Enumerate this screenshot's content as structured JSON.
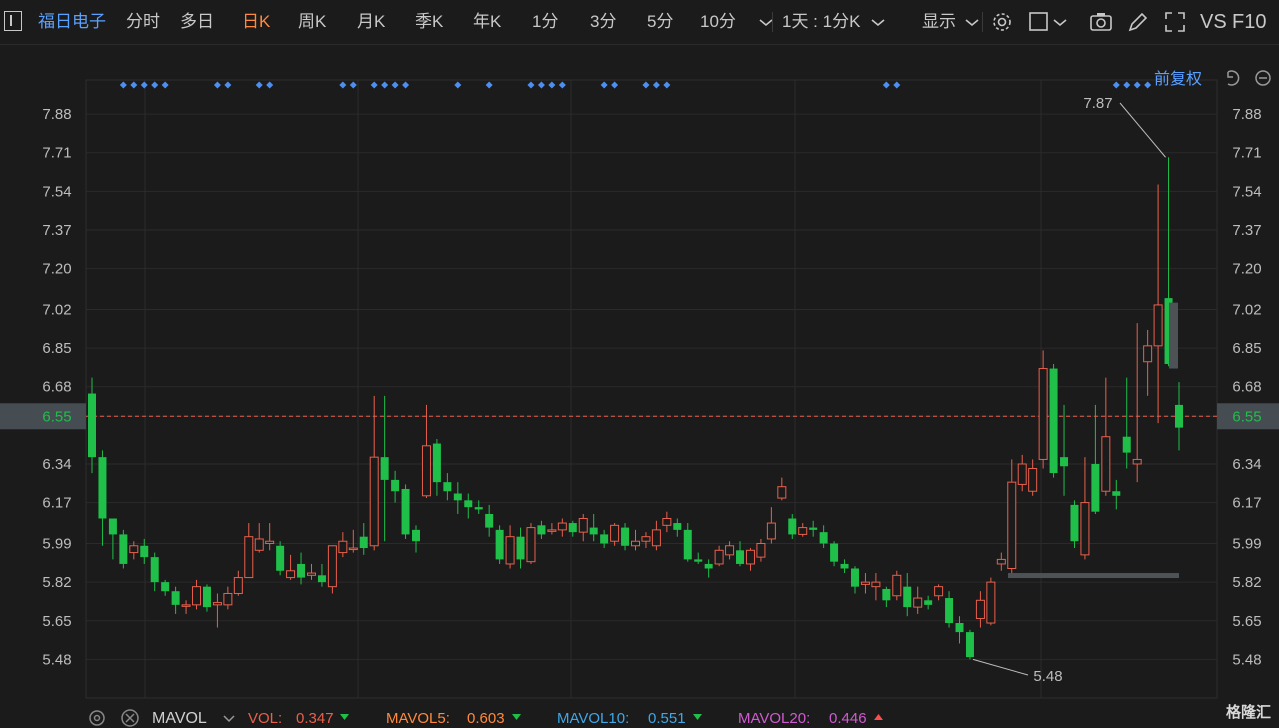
{
  "toolbar": {
    "stock_name": "福日电子",
    "tabs": [
      "分时",
      "多日",
      "日K",
      "周K",
      "月K",
      "季K",
      "年K",
      "1分",
      "3分",
      "5分",
      "10分"
    ],
    "active_tab": "日K",
    "period_select": "1天 : 1分K",
    "display_label": "显示",
    "right_labels": [
      "VS",
      "F10"
    ]
  },
  "adjust_label": "前复权",
  "price_marker": {
    "current": "6.55",
    "high_label": "7.87",
    "low_label": "5.48"
  },
  "footer": {
    "indicator": "MAVOL",
    "items": [
      {
        "name": "VOL:",
        "value": "0.347",
        "name_color": "#e8604c",
        "value_color": "#e8604c",
        "arrow": "down",
        "arrow_color": "#1fbf4a"
      },
      {
        "name": "MAVOL5:",
        "value": "0.603",
        "name_color": "#ff8a3d",
        "value_color": "#ff8a3d",
        "arrow": "down",
        "arrow_color": "#1fbf4a"
      },
      {
        "name": "MAVOL10:",
        "value": "0.551",
        "name_color": "#3fa7e8",
        "value_color": "#3fa7e8",
        "arrow": "down",
        "arrow_color": "#1fbf4a"
      },
      {
        "name": "MAVOL20:",
        "value": "0.446",
        "name_color": "#d05ad0",
        "value_color": "#d05ad0",
        "arrow": "up",
        "arrow_color": "#ff4c4c"
      }
    ]
  },
  "watermark": "格隆汇",
  "chart_data": {
    "type": "candlestick",
    "y_ticks": [
      "7.88",
      "7.71",
      "7.54",
      "7.37",
      "7.20",
      "7.02",
      "6.85",
      "6.68",
      "6.55",
      "6.34",
      "6.17",
      "5.99",
      "5.82",
      "5.65",
      "5.48"
    ],
    "y_range": [
      5.31,
      8.03
    ],
    "current_price": 6.55,
    "up_color": "#e8604c",
    "down_color": "#1fbf4a",
    "marker_color": "#4c8ff0",
    "markers": [
      3,
      4,
      5,
      6,
      7,
      12,
      13,
      16,
      17,
      24,
      25,
      27,
      28,
      29,
      30,
      35,
      38,
      42,
      43,
      44,
      45,
      49,
      50,
      53,
      54,
      55,
      76,
      77,
      98,
      99,
      100,
      101
    ],
    "candles": [
      [
        6.65,
        6.37,
        6.72,
        6.3
      ],
      [
        6.37,
        6.1,
        6.4,
        5.98
      ],
      [
        6.1,
        6.03,
        6.1,
        5.92
      ],
      [
        6.03,
        5.9,
        6.05,
        5.88
      ],
      [
        5.95,
        5.98,
        6.0,
        5.92
      ],
      [
        5.98,
        5.93,
        6.01,
        5.9
      ],
      [
        5.93,
        5.82,
        5.95,
        5.78
      ],
      [
        5.82,
        5.78,
        5.83,
        5.76
      ],
      [
        5.78,
        5.72,
        5.8,
        5.68
      ],
      [
        5.72,
        5.72,
        5.74,
        5.68
      ],
      [
        5.72,
        5.8,
        5.83,
        5.7
      ],
      [
        5.8,
        5.71,
        5.81,
        5.69
      ],
      [
        5.72,
        5.73,
        5.77,
        5.62
      ],
      [
        5.72,
        5.77,
        5.8,
        5.7
      ],
      [
        5.77,
        5.84,
        5.87,
        5.76
      ],
      [
        5.84,
        6.02,
        6.08,
        5.84
      ],
      [
        5.96,
        6.01,
        6.08,
        5.95
      ],
      [
        5.99,
        6.0,
        6.08,
        5.96
      ],
      [
        5.98,
        5.87,
        6.0,
        5.85
      ],
      [
        5.84,
        5.87,
        5.94,
        5.83
      ],
      [
        5.9,
        5.84,
        5.95,
        5.81
      ],
      [
        5.85,
        5.86,
        5.9,
        5.83
      ],
      [
        5.85,
        5.82,
        5.9,
        5.8
      ],
      [
        5.8,
        5.98,
        5.98,
        5.77
      ],
      [
        5.95,
        6.0,
        6.04,
        5.93
      ],
      [
        5.97,
        5.97,
        6.05,
        5.95
      ],
      [
        6.02,
        5.97,
        6.08,
        5.94
      ],
      [
        5.98,
        6.37,
        6.64,
        5.96
      ],
      [
        6.37,
        6.27,
        6.64,
        6.0
      ],
      [
        6.27,
        6.22,
        6.31,
        6.17
      ],
      [
        6.23,
        6.03,
        6.25,
        6.01
      ],
      [
        6.05,
        6.0,
        6.07,
        5.95
      ],
      [
        6.2,
        6.42,
        6.6,
        6.19
      ],
      [
        6.43,
        6.26,
        6.45,
        6.2
      ],
      [
        6.26,
        6.22,
        6.3,
        6.18
      ],
      [
        6.21,
        6.18,
        6.26,
        6.12
      ],
      [
        6.18,
        6.15,
        6.21,
        6.1
      ],
      [
        6.15,
        6.14,
        6.18,
        6.12
      ],
      [
        6.12,
        6.06,
        6.16,
        6.02
      ],
      [
        6.05,
        5.92,
        6.07,
        5.9
      ],
      [
        5.9,
        6.02,
        6.07,
        5.88
      ],
      [
        6.02,
        5.92,
        6.06,
        5.88
      ],
      [
        5.91,
        6.06,
        6.08,
        5.9
      ],
      [
        6.07,
        6.03,
        6.09,
        6.01
      ],
      [
        6.05,
        6.05,
        6.08,
        6.03
      ],
      [
        6.05,
        6.08,
        6.1,
        6.02
      ],
      [
        6.08,
        6.04,
        6.09,
        6.02
      ],
      [
        6.04,
        6.1,
        6.12,
        6.0
      ],
      [
        6.06,
        6.03,
        6.12,
        6.0
      ],
      [
        6.03,
        5.99,
        6.05,
        5.97
      ],
      [
        6.0,
        6.07,
        6.08,
        5.98
      ],
      [
        6.06,
        5.98,
        6.08,
        5.96
      ],
      [
        5.98,
        6.0,
        6.05,
        5.96
      ],
      [
        6.0,
        6.02,
        6.04,
        5.97
      ],
      [
        5.98,
        6.05,
        6.09,
        5.96
      ],
      [
        6.07,
        6.1,
        6.13,
        6.04
      ],
      [
        6.08,
        6.05,
        6.1,
        6.02
      ],
      [
        6.05,
        5.92,
        6.08,
        5.91
      ],
      [
        5.92,
        5.91,
        5.95,
        5.9
      ],
      [
        5.9,
        5.88,
        5.92,
        5.84
      ],
      [
        5.9,
        5.96,
        5.98,
        5.89
      ],
      [
        5.94,
        5.98,
        6.0,
        5.92
      ],
      [
        5.96,
        5.9,
        6.0,
        5.89
      ],
      [
        5.9,
        5.96,
        5.97,
        5.87
      ],
      [
        5.93,
        5.99,
        6.01,
        5.91
      ],
      [
        6.01,
        6.08,
        6.15,
        5.99
      ],
      [
        6.19,
        6.24,
        6.28,
        6.18
      ],
      [
        6.1,
        6.03,
        6.12,
        6.01
      ],
      [
        6.03,
        6.06,
        6.08,
        6.02
      ],
      [
        6.06,
        6.05,
        6.09,
        6.02
      ],
      [
        6.04,
        5.99,
        6.07,
        5.97
      ],
      [
        5.99,
        5.91,
        6.0,
        5.89
      ],
      [
        5.9,
        5.88,
        5.92,
        5.86
      ],
      [
        5.88,
        5.8,
        5.89,
        5.77
      ],
      [
        5.81,
        5.82,
        5.86,
        5.77
      ],
      [
        5.8,
        5.82,
        5.86,
        5.74
      ],
      [
        5.79,
        5.74,
        5.8,
        5.71
      ],
      [
        5.76,
        5.85,
        5.87,
        5.74
      ],
      [
        5.8,
        5.71,
        5.86,
        5.67
      ],
      [
        5.71,
        5.75,
        5.8,
        5.68
      ],
      [
        5.74,
        5.72,
        5.76,
        5.7
      ],
      [
        5.76,
        5.8,
        5.81,
        5.74
      ],
      [
        5.75,
        5.64,
        5.78,
        5.62
      ],
      [
        5.64,
        5.6,
        5.67,
        5.55
      ],
      [
        5.6,
        5.49,
        5.61,
        5.48
      ],
      [
        5.66,
        5.74,
        5.78,
        5.62
      ],
      [
        5.64,
        5.82,
        5.84,
        5.63
      ],
      [
        5.9,
        5.92,
        5.95,
        5.87
      ],
      [
        5.88,
        6.26,
        6.36,
        5.84
      ],
      [
        6.25,
        6.34,
        6.38,
        6.22
      ],
      [
        6.22,
        6.32,
        6.36,
        6.2
      ],
      [
        6.36,
        6.76,
        6.84,
        6.32
      ],
      [
        6.76,
        6.3,
        6.78,
        6.28
      ],
      [
        6.37,
        6.33,
        6.6,
        6.2
      ],
      [
        6.16,
        6.0,
        6.18,
        5.97
      ],
      [
        5.94,
        6.17,
        6.37,
        5.92
      ],
      [
        6.34,
        6.13,
        6.6,
        6.12
      ],
      [
        6.22,
        6.46,
        6.72,
        6.2
      ],
      [
        6.22,
        6.2,
        6.27,
        6.14
      ],
      [
        6.46,
        6.39,
        6.72,
        6.32
      ],
      [
        6.34,
        6.36,
        6.96,
        6.26
      ],
      [
        6.79,
        6.86,
        6.93,
        6.64
      ],
      [
        6.86,
        7.04,
        7.57,
        6.52
      ],
      [
        7.07,
        6.78,
        7.69,
        6.77
      ],
      [
        6.6,
        6.5,
        6.7,
        6.4
      ]
    ]
  }
}
